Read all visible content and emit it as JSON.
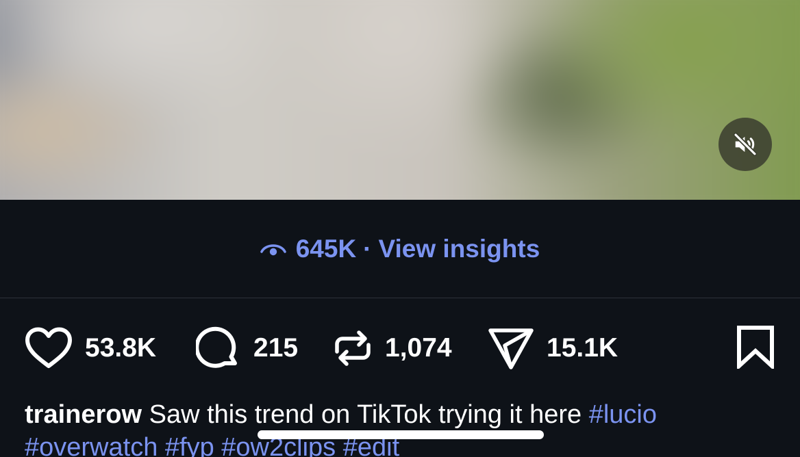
{
  "media": {
    "mute_icon": "speaker-muted-icon"
  },
  "insights": {
    "icon": "eye-icon",
    "views": "645K",
    "separator": "·",
    "link_label": "View insights",
    "color": "#7b93f0"
  },
  "actions": {
    "like": {
      "icon": "heart-icon",
      "count": "53.8K"
    },
    "comment": {
      "icon": "comment-bubble-icon",
      "count": "215"
    },
    "repost": {
      "icon": "repost-icon",
      "count": "1,074"
    },
    "share": {
      "icon": "send-icon",
      "count": "15.1K"
    },
    "bookmark": {
      "icon": "bookmark-icon"
    }
  },
  "caption": {
    "username": "trainerow",
    "text": "Saw this trend on TikTok trying it here",
    "hashtags": [
      "#lucio",
      "#overwatch",
      "#fyp",
      "#ow2clips",
      "#edit"
    ]
  }
}
